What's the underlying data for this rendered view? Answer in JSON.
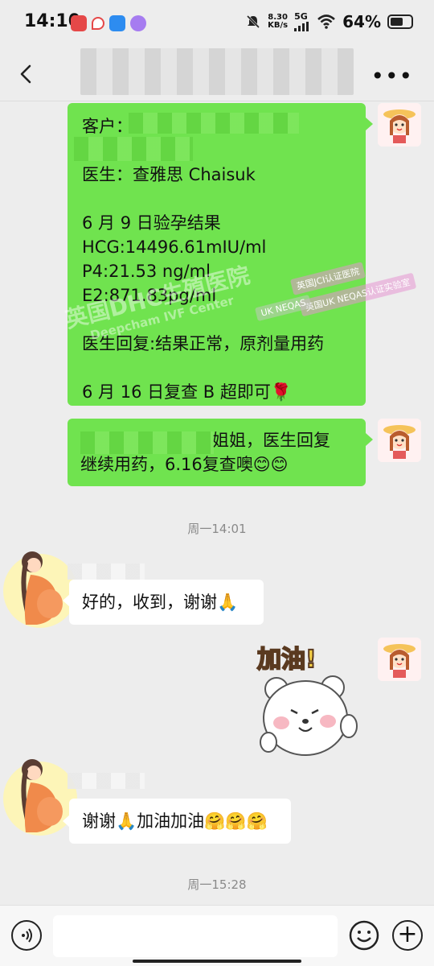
{
  "status": {
    "time": "14:10",
    "speed_value": "8.30",
    "speed_unit": "KB/s",
    "network": "5G",
    "battery": "64%",
    "battery_level": 0.64
  },
  "messages": {
    "m1": {
      "lines": [
        "客户：",
        "",
        "医生：查雅思 Chaisuk",
        "",
        "6 月 9 日验孕结果",
        "HCG:14496.61mIU/ml",
        "P4:21.53 ng/ml",
        "E2:871.83pg/ml",
        "",
        "医生回复:结果正常，原剂量用药",
        "",
        "6 月 16 日复查 B 超即可🌹"
      ]
    },
    "m2": {
      "line1": "姐姐，医生回复",
      "line2": "继续用药，6.16复查噢😊😊"
    },
    "time1": "周一14:01",
    "m3": {
      "text": "好的，收到，谢谢🙏"
    },
    "sticker": {
      "text": "加油!"
    },
    "m4": {
      "text": "谢谢🙏加油加油🤗🤗🤗"
    },
    "time2": "周一15:28"
  },
  "watermark": {
    "main": "英国DHC生殖医院",
    "sub": "Deepcham IVF Center",
    "badge1": "英国JCI认证医院",
    "badge2": "英国UK NEQAS认证实验室",
    "badge3": "UK NEQAS"
  }
}
